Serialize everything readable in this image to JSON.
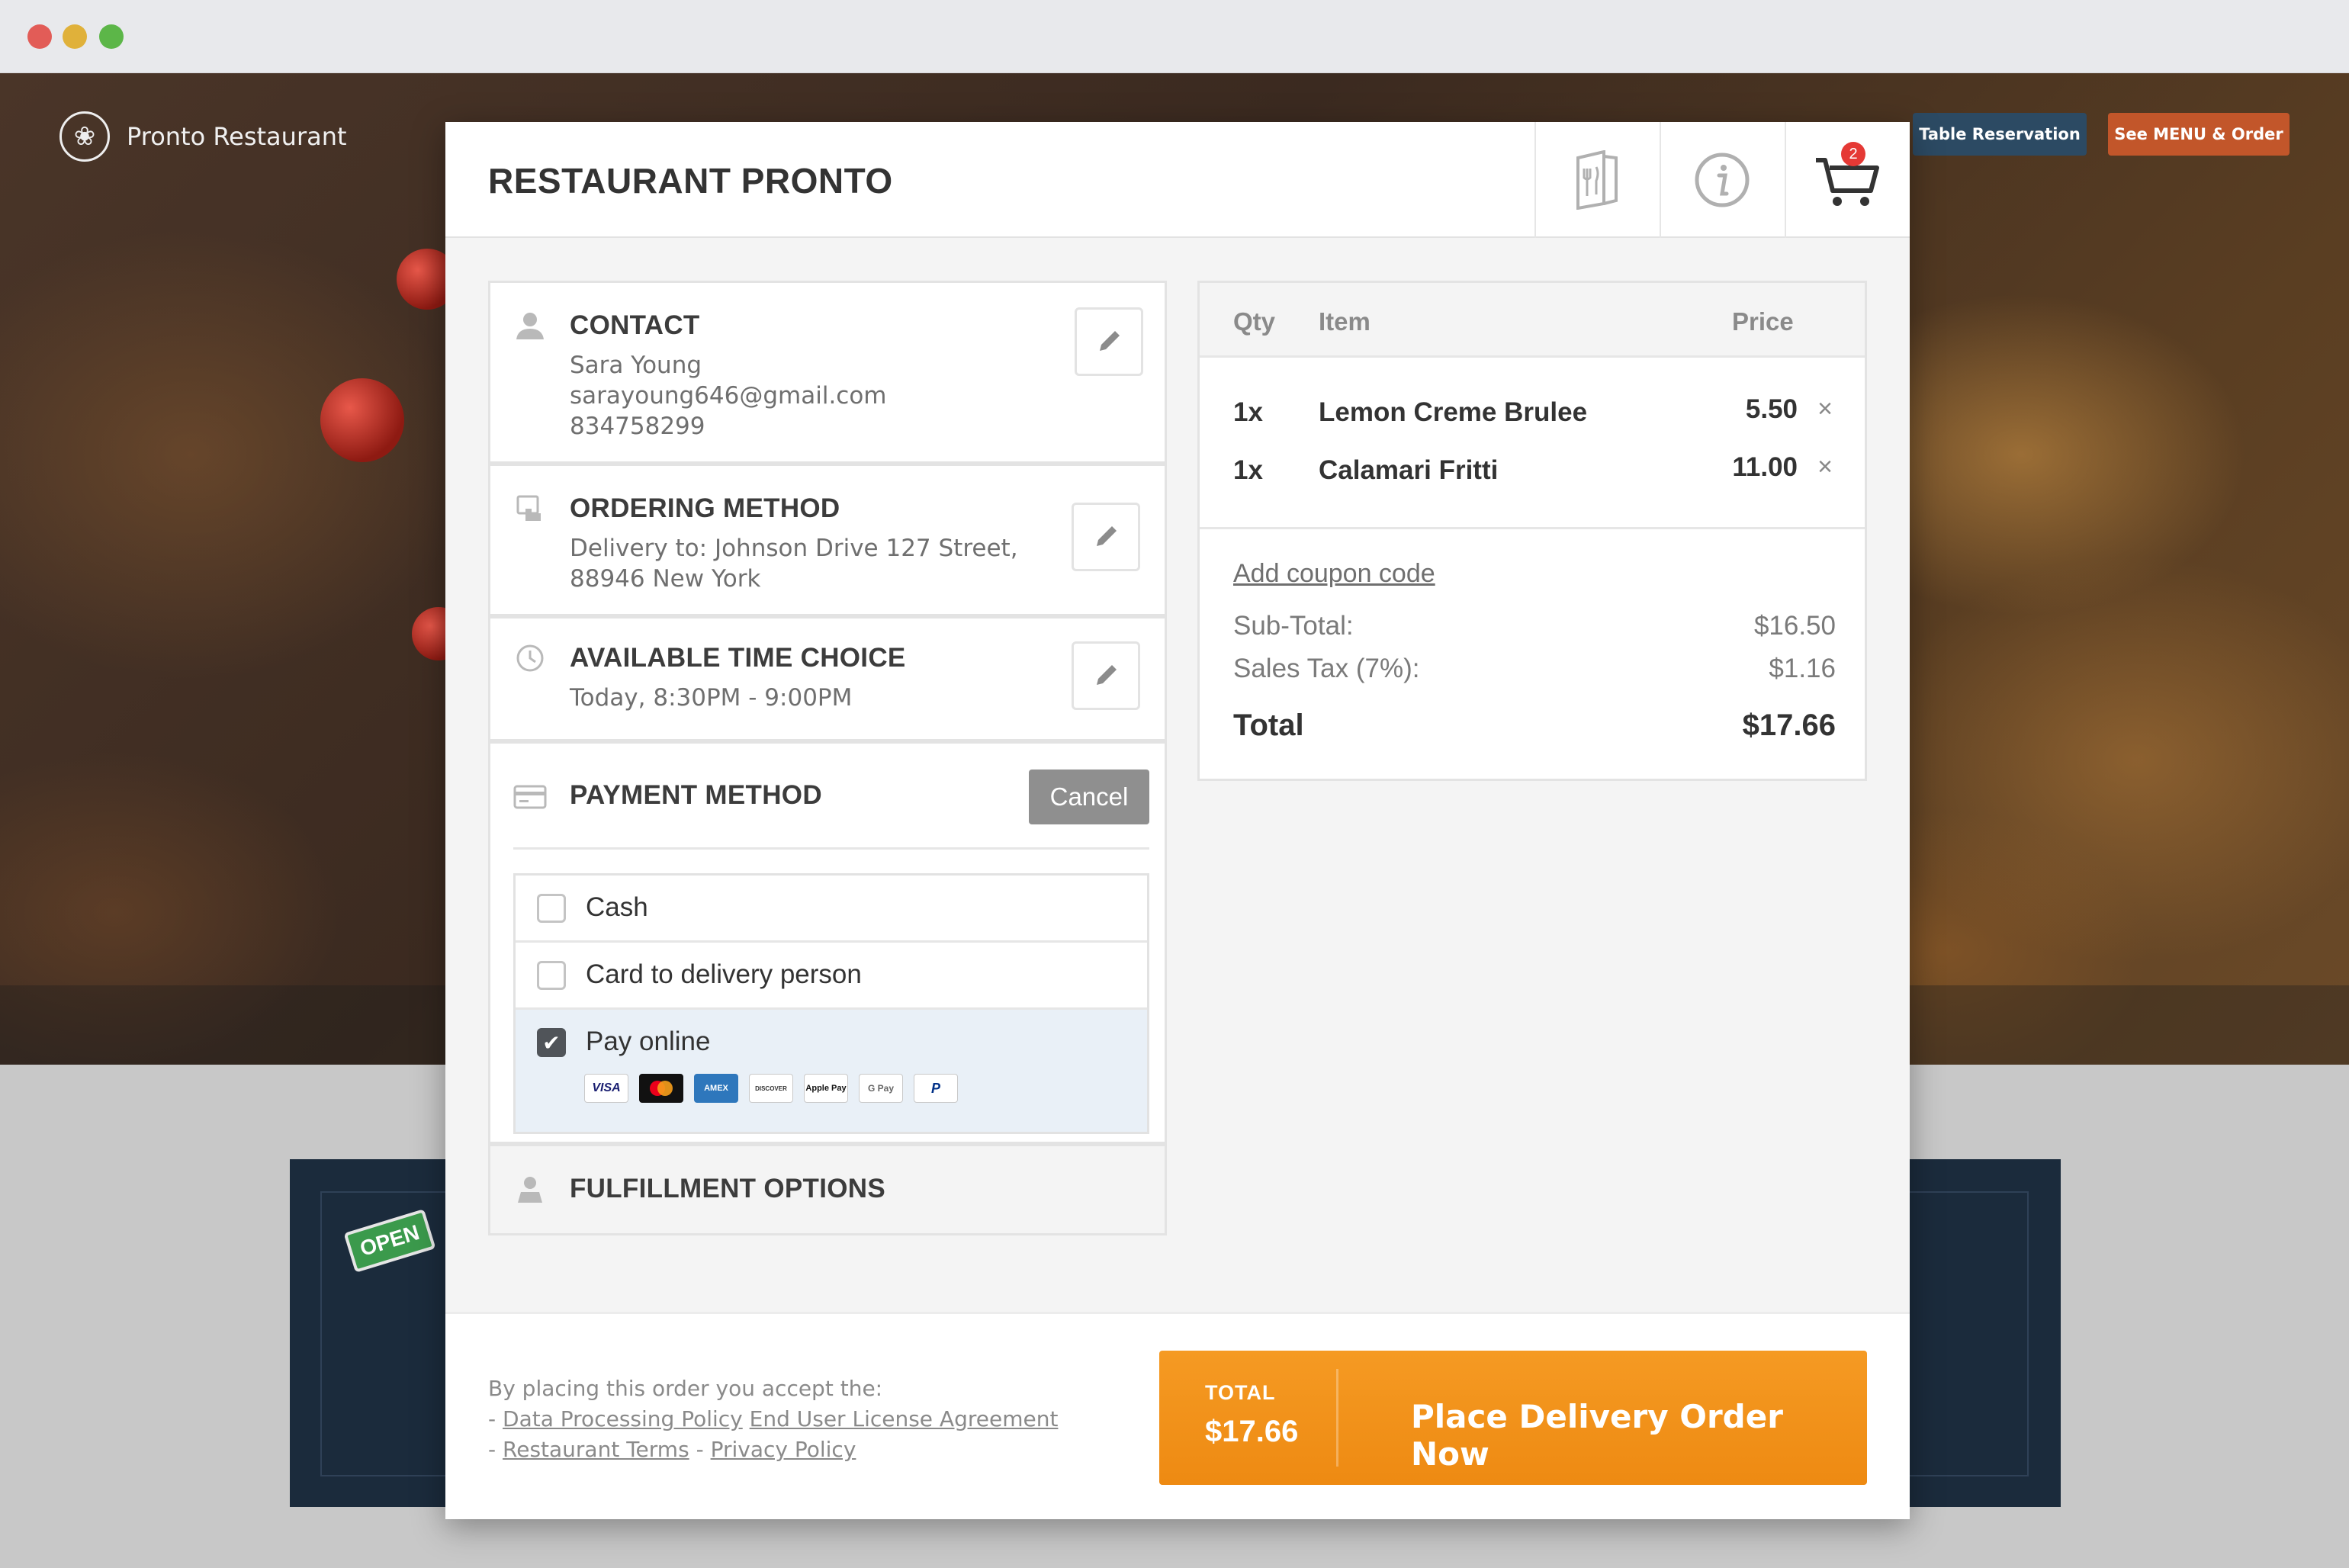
{
  "site": {
    "brand_name": "Pronto Restaurant",
    "nav_reservation": "Table Reservation",
    "nav_menu_order": "See MENU & Order",
    "open_sign": "OPEN"
  },
  "modal": {
    "title": "RESTAURANT PRONTO",
    "cart_count": "2",
    "contact": {
      "title": "CONTACT",
      "name": "Sara Young",
      "email": "sarayoung646@gmail.com",
      "phone": "834758299"
    },
    "ordering_method": {
      "title": "ORDERING METHOD",
      "line1": "Delivery to: Johnson Drive 127 Street,",
      "line2": "88946 New York"
    },
    "time_choice": {
      "title": "AVAILABLE TIME CHOICE",
      "value": "Today, 8:30PM - 9:00PM"
    },
    "payment": {
      "title": "PAYMENT METHOD",
      "cancel_label": "Cancel",
      "options": [
        {
          "label": "Cash",
          "checked": false
        },
        {
          "label": "Card to delivery person",
          "checked": false
        },
        {
          "label": "Pay online",
          "checked": true
        }
      ],
      "card_logos": [
        "VISA",
        "MC",
        "AMEX",
        "DISCOVER",
        "Apple Pay",
        "G Pay",
        "PayPal"
      ]
    },
    "fulfillment": {
      "title": "FULFILLMENT OPTIONS"
    },
    "summary": {
      "headers": {
        "qty": "Qty",
        "item": "Item",
        "price": "Price"
      },
      "items": [
        {
          "qty": "1x",
          "name": "Lemon Creme Brulee",
          "price": "5.50"
        },
        {
          "qty": "1x",
          "name": "Calamari Fritti",
          "price": "11.00"
        }
      ],
      "coupon_label": "Add coupon code",
      "subtotal_label": "Sub-Total:",
      "subtotal": "$16.50",
      "tax_label": "Sales Tax (7%):",
      "tax": "$1.16",
      "total_label": "Total",
      "total": "$17.66"
    },
    "footer": {
      "accept_text": "By placing this order you accept the:",
      "link_data_policy": "Data Processing Policy",
      "link_eula": "End User License Agreement",
      "link_terms": "Restaurant Terms",
      "link_privacy": "Privacy Policy",
      "total_label": "TOTAL",
      "total_value": "$17.66",
      "order_button": "Place Delivery Order Now"
    }
  },
  "colors": {
    "accent_orange": "#f0901a",
    "reservation_button": "#2c4a63",
    "menu_button": "#c2562a",
    "cart_badge": "#e53935"
  }
}
